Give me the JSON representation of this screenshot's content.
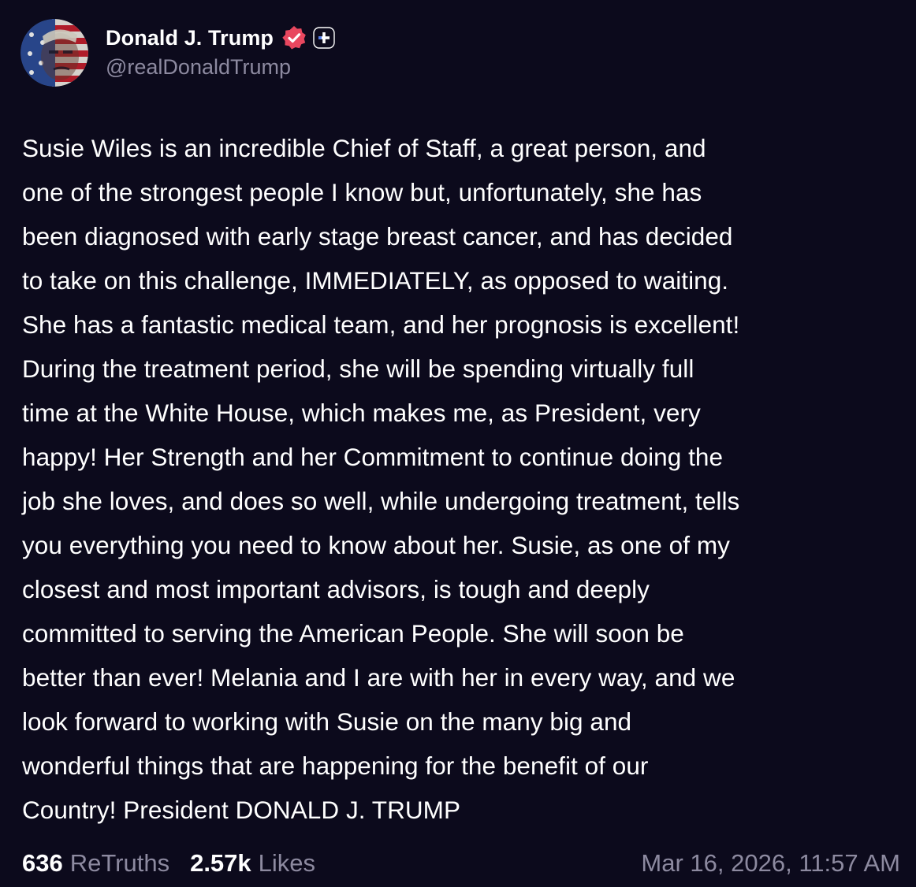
{
  "author": {
    "display_name": "Donald J. Trump",
    "handle": "@realDonaldTrump",
    "avatar_icon": "flag-portrait-avatar",
    "verified_icon": "verified-badge-icon",
    "plus_icon": "plus-badge-icon"
  },
  "post": {
    "text": "Susie Wiles is an incredible Chief of Staff, a great person, and\none of the strongest people I know but, unfortunately, she has\nbeen diagnosed with early stage breast cancer, and has decided\nto take on this challenge, IMMEDIATELY, as opposed to waiting.\nShe has a fantastic medical team, and her prognosis is excellent!\nDuring the treatment period, she will be spending virtually full\ntime at the White House, which makes me, as President, very\nhappy! Her Strength and her Commitment to continue doing the\njob she loves, and does so well, while undergoing treatment, tells\nyou everything you need to know about her. Susie, as one of my\nclosest and most important advisors, is tough and deeply\ncommitted to serving the American People. She will soon be\nbetter than ever! Melania and I are with her in every way, and we\nlook forward to working with Susie on the many big and\nwonderful things that are happening for the benefit of our\nCountry! President DONALD J. TRUMP"
  },
  "stats": {
    "retruths_count": "636",
    "retruths_label": "ReTruths",
    "likes_count": "2.57k",
    "likes_label": "Likes",
    "timestamp": "Mar 16, 2026, 11:57 AM"
  },
  "colors": {
    "background": "#0c0a1c",
    "text_primary": "#ffffff",
    "text_secondary": "#8d8aa0",
    "verified_badge": "#e8475f"
  }
}
